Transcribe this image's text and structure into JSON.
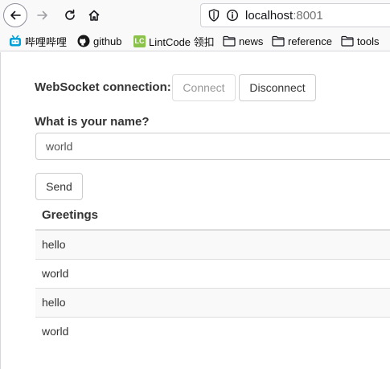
{
  "browser": {
    "url_host": "localhost",
    "url_port": ":8001",
    "icons": [
      "back-icon",
      "forward-icon",
      "reload-icon",
      "home-icon",
      "shield-icon",
      "info-icon"
    ]
  },
  "bookmarks": [
    {
      "label": "哔哩哔哩",
      "icon": "bilibili-icon"
    },
    {
      "label": "github",
      "icon": "github-icon"
    },
    {
      "label": "LintCode 领扣",
      "icon": "lintcode-icon",
      "badge": "LC"
    },
    {
      "label": "news",
      "icon": "folder-icon"
    },
    {
      "label": "reference",
      "icon": "folder-icon"
    },
    {
      "label": "tools",
      "icon": "folder-icon"
    }
  ],
  "page": {
    "ws_label": "WebSocket connection:",
    "connect_label": "Connect",
    "disconnect_label": "Disconnect",
    "name_label": "What is your name?",
    "name_value": "world",
    "send_label": "Send",
    "greetings_header": "Greetings",
    "greetings": [
      "hello",
      "world",
      "hello",
      "world"
    ]
  },
  "colors": {
    "accent_bili": "#00a1d6",
    "lintcode": "#8bc34a",
    "row_stripe": "#f9f9f9"
  }
}
